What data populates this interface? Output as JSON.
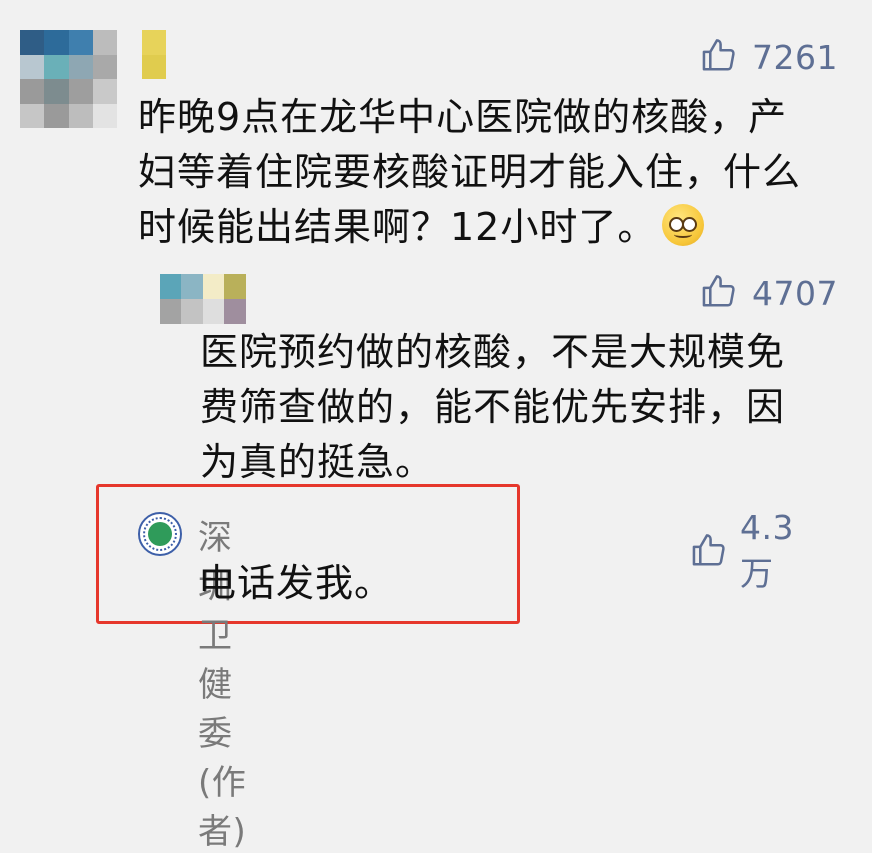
{
  "comments": [
    {
      "likes": "7261",
      "lines": [
        "昨晚9点在龙华中心医院做的核酸，产",
        "妇等着住院要核酸证明才能入住，什么",
        "时候能出结果啊？12小时了。"
      ],
      "emoji": "woozy-face-icon"
    },
    {
      "likes": "4707",
      "lines": [
        "医院预约做的核酸，不是大规模免",
        "费筛查做的，能不能优先安排，因",
        "为真的挺急。"
      ]
    },
    {
      "author": "深圳卫健委(作者)",
      "likes": "4.3万",
      "lines": [
        "电话发我。"
      ]
    }
  ],
  "colors": {
    "background": "#f1f1f1",
    "like": "#5e6f94",
    "highlight": "#e6372c",
    "author": "#7a7a7a"
  }
}
